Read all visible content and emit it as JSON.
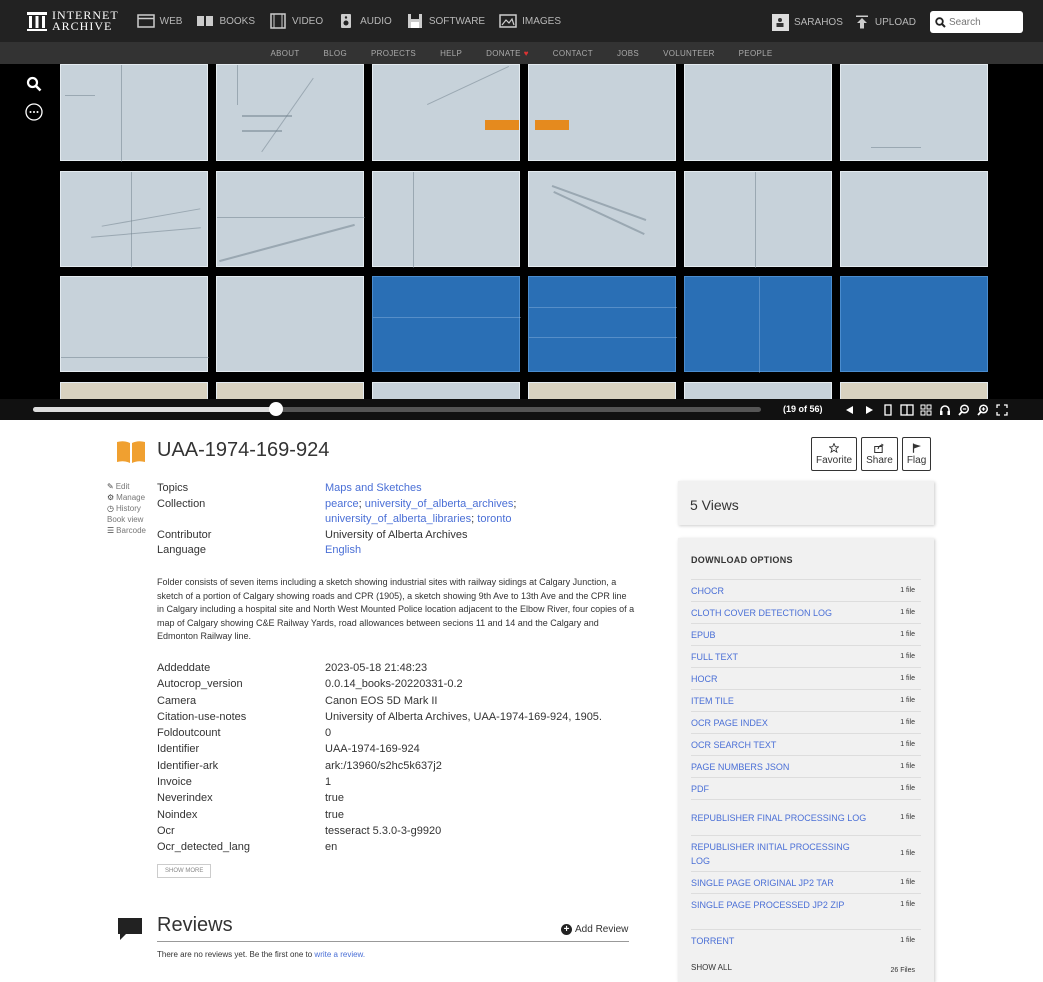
{
  "nav": {
    "logo_line1": "INTERNET",
    "logo_line2": "ARCHIVE",
    "links": [
      "WEB",
      "BOOKS",
      "VIDEO",
      "AUDIO",
      "SOFTWARE",
      "IMAGES"
    ],
    "user": "SARAHOS",
    "upload": "UPLOAD",
    "search_placeholder": "Search"
  },
  "subnav": [
    "ABOUT",
    "BLOG",
    "PROJECTS",
    "HELP",
    "DONATE",
    "CONTACT",
    "JOBS",
    "VOLUNTEER",
    "PEOPLE"
  ],
  "viewer": {
    "page_count": "(19 of 56)",
    "progress": 0.33
  },
  "item": {
    "title": "UAA-1974-169-924",
    "actions": [
      "Favorite",
      "Share",
      "Flag"
    ],
    "edit_links": [
      "Edit",
      "Manage",
      "History",
      "Book view",
      "Barcode"
    ],
    "meta": {
      "topics_label": "Topics",
      "topics": "Maps and Sketches",
      "collection_label": "Collection",
      "collection_1": "pearce",
      "collection_2": "university_of_alberta_archives",
      "collection_3": "university_of_alberta_libraries",
      "collection_4": "toronto",
      "contributor_label": "Contributor",
      "contributor": "University of Alberta Archives",
      "language_label": "Language",
      "language": "English"
    },
    "description": "Folder consists of seven items including a sketch showing industrial sites with railway sidings at Calgary Junction, a sketch of a portion of Calgary showing roads and CPR (1905), a sketch showing 9th Ave to 13th Ave and the CPR line in Calgary including a hospital site and North West Mounted Police location adjacent to the Elbow River, four copies of a map of Calgary showing C&E Railway Yards, road allowances between secions 11 and 14 and the Calgary and Edmonton Railway line.",
    "extra_meta": [
      {
        "key": "Addeddate",
        "value": "2023-05-18 21:48:23"
      },
      {
        "key": "Autocrop_version",
        "value": "0.0.14_books-20220331-0.2"
      },
      {
        "key": "Camera",
        "value": "Canon EOS 5D Mark II"
      },
      {
        "key": "Citation-use-notes",
        "value": "University of Alberta Archives, UAA-1974-169-924, 1905."
      },
      {
        "key": "Foldoutcount",
        "value": "0"
      },
      {
        "key": "Identifier",
        "value": "UAA-1974-169-924"
      },
      {
        "key": "Identifier-ark",
        "value": "ark:/13960/s2hc5k637j2"
      },
      {
        "key": "Invoice",
        "value": "1"
      },
      {
        "key": "Neverindex",
        "value": "true"
      },
      {
        "key": "Noindex",
        "value": "true"
      },
      {
        "key": "Ocr",
        "value": "tesseract 5.3.0-3-g9920"
      },
      {
        "key": "Ocr_detected_lang",
        "value": "en"
      }
    ],
    "show_more": "SHOW MORE"
  },
  "reviews": {
    "title": "Reviews",
    "add": "Add Review",
    "none_text": "There are no reviews yet. Be the first one to ",
    "none_link": "write a review."
  },
  "sidebar": {
    "views": "5 Views",
    "download_title": "DOWNLOAD OPTIONS",
    "downloads": [
      {
        "name": "CHOCR",
        "count": "1 file"
      },
      {
        "name": "CLOTH COVER DETECTION LOG",
        "count": "1 file"
      },
      {
        "name": "EPUB",
        "count": "1 file"
      },
      {
        "name": "FULL TEXT",
        "count": "1 file"
      },
      {
        "name": "HOCR",
        "count": "1 file"
      },
      {
        "name": "ITEM TILE",
        "count": "1 file"
      },
      {
        "name": "OCR PAGE INDEX",
        "count": "1 file"
      },
      {
        "name": "OCR SEARCH TEXT",
        "count": "1 file"
      },
      {
        "name": "PAGE NUMBERS JSON",
        "count": "1 file"
      },
      {
        "name": "PDF",
        "count": "1 file"
      },
      {
        "name": "REPUBLISHER FINAL PROCESSING LOG",
        "count": "1 file"
      },
      {
        "name": "REPUBLISHER INITIAL PROCESSING LOG",
        "count": "1 file"
      },
      {
        "name": "SINGLE PAGE ORIGINAL JP2 TAR",
        "count": "1 file"
      },
      {
        "name": "SINGLE PAGE PROCESSED JP2 ZIP",
        "count": "1 file"
      },
      {
        "name": "TORRENT",
        "count": "1 file"
      }
    ],
    "show_all": "SHOW ALL",
    "total_files": "26 Files"
  },
  "colors": {
    "link": "#4a6fd6",
    "topbar": "#222222",
    "subnav": "#333333",
    "map_paper": "#c7d2da",
    "blueprint": "#2a6fb5",
    "tape": "#e58a1e",
    "book_icon": "#f0a030"
  }
}
